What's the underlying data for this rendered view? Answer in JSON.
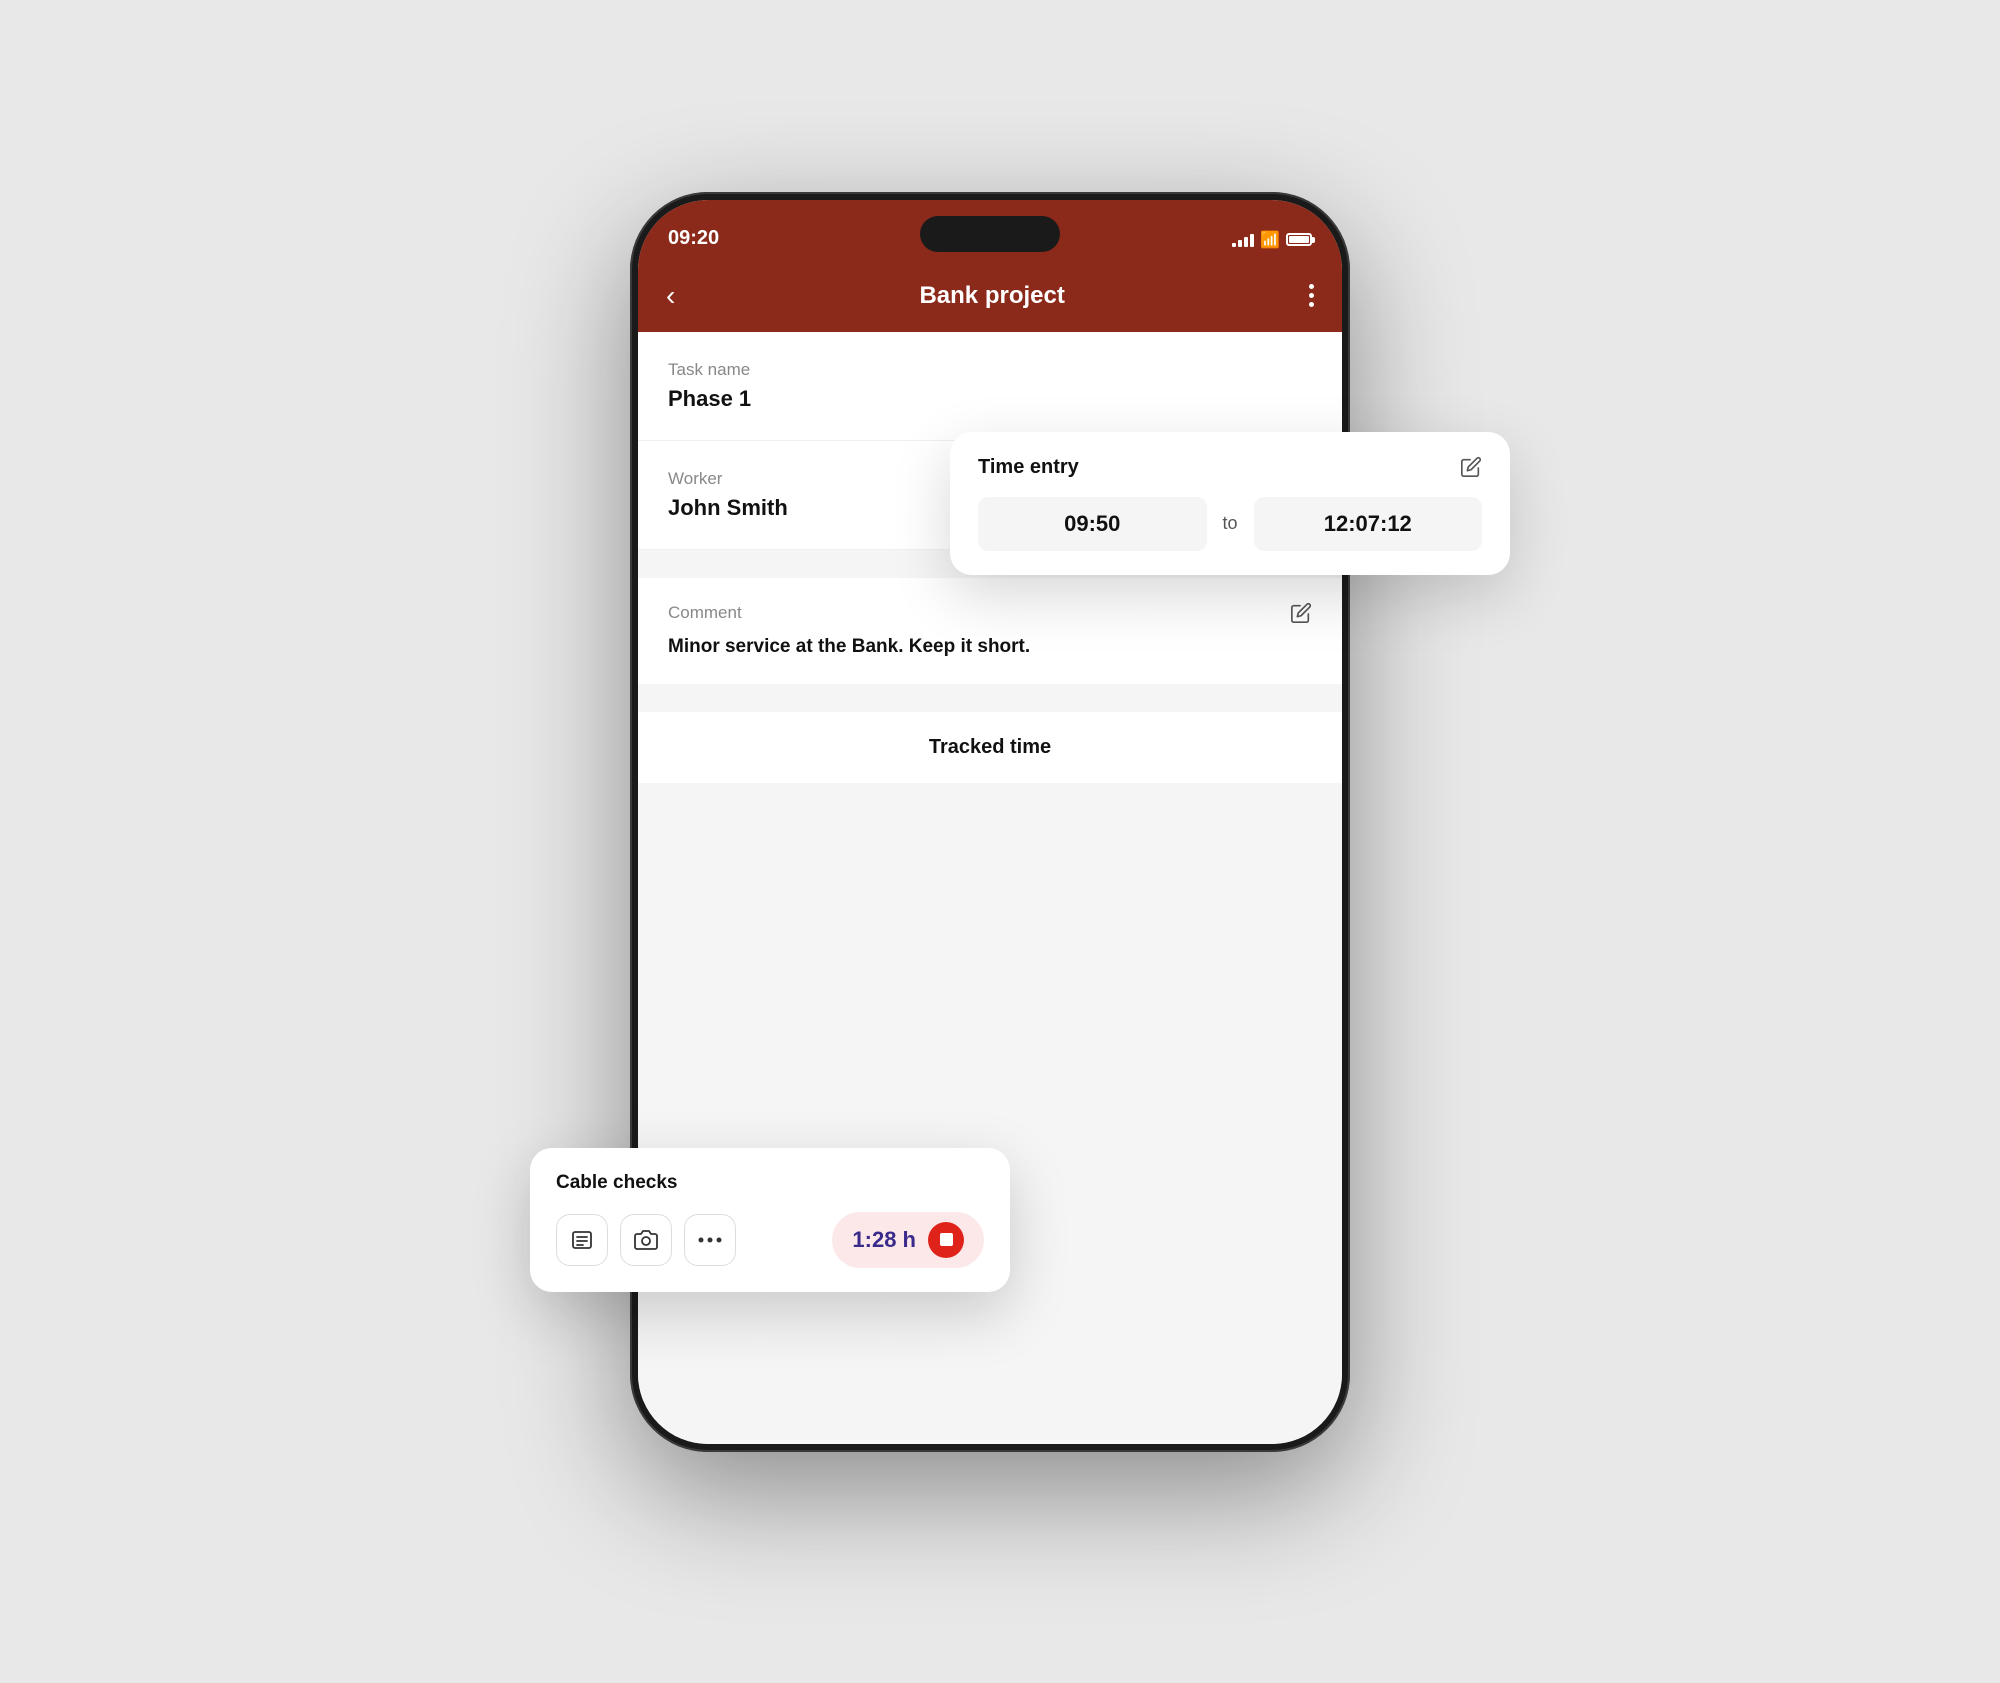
{
  "scene": {
    "background_color": "#e8e8e8"
  },
  "phone": {
    "status_bar": {
      "time": "09:20",
      "signal_label": "signal",
      "wifi_label": "wifi",
      "battery_label": "battery"
    },
    "nav": {
      "back_label": "‹",
      "title": "Bank project",
      "more_label": "⋮"
    },
    "task_section": {
      "label": "Task name",
      "value": "Phase 1"
    },
    "worker_section": {
      "label": "Worker",
      "value": "John Smith"
    },
    "comment_section": {
      "label": "Comment",
      "value": "Minor service at the Bank. Keep it short.",
      "edit_label": "edit"
    },
    "tracked_section": {
      "title": "Tracked time"
    }
  },
  "time_entry_card": {
    "title": "Time entry",
    "edit_label": "edit",
    "start_time": "09:50",
    "separator": "to",
    "end_time": "12:07:12"
  },
  "cable_checks_card": {
    "title": "Cable checks",
    "actions": [
      {
        "icon": "list",
        "label": "list-icon"
      },
      {
        "icon": "camera",
        "label": "camera-icon"
      },
      {
        "icon": "more",
        "label": "more-icon"
      }
    ],
    "timer": "1:28 h",
    "stop_label": "stop"
  }
}
